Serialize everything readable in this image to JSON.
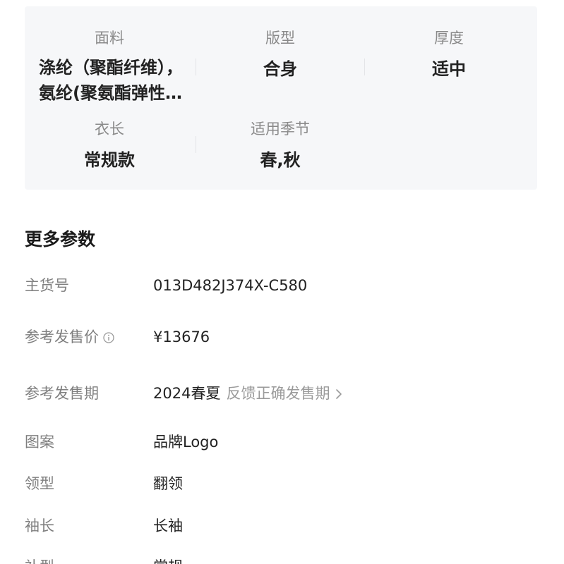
{
  "summary": {
    "row1": [
      {
        "label": "面料",
        "value_lines": [
          "涤纶（聚酯纤维），",
          "氨纶(聚氨酯弹性…"
        ]
      },
      {
        "label": "版型",
        "value": "合身"
      },
      {
        "label": "厚度",
        "value": "适中"
      }
    ],
    "row2": [
      {
        "label": "衣长",
        "value": "常规款"
      },
      {
        "label": "适用季节",
        "value": "春,秋"
      }
    ]
  },
  "more_params": {
    "title": "更多参数",
    "items": [
      {
        "label": "主货号",
        "value": "013D482J374X-C580"
      },
      {
        "label": "参考发售价",
        "value": "¥13676",
        "icon": "info-icon"
      },
      {
        "label": "参考发售期",
        "value": "2024春夏",
        "link": "反馈正确发售期",
        "link_icon": "chevron-right-icon"
      },
      {
        "label": "图案",
        "value": "品牌Logo"
      },
      {
        "label": "领型",
        "value": "翻领"
      },
      {
        "label": "袖长",
        "value": "长袖"
      },
      {
        "label": "补型",
        "value": "常规"
      }
    ]
  },
  "colors": {
    "card_bg": "#f6f7f9",
    "label": "#7f7f7f",
    "value": "#222222",
    "link": "#9a9a9a"
  }
}
